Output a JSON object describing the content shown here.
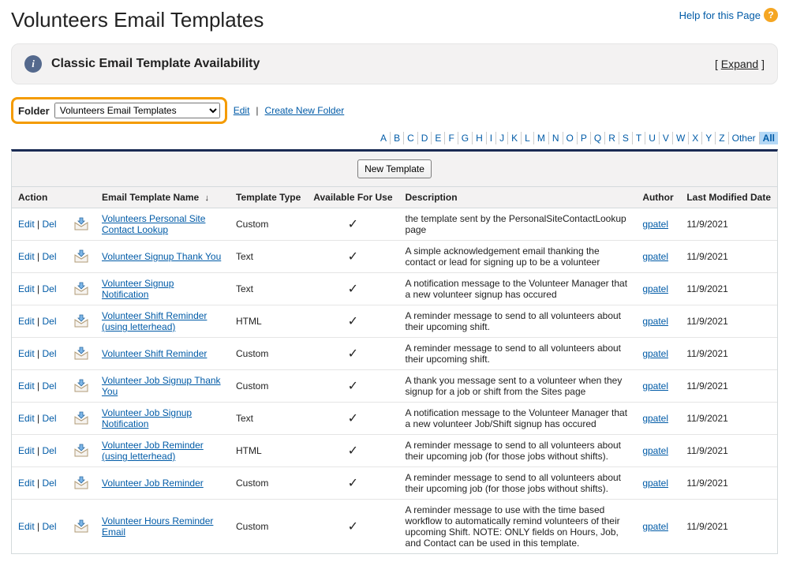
{
  "page": {
    "title": "Volunteers Email Templates",
    "help_label": "Help for this Page"
  },
  "banner": {
    "title": "Classic Email Template Availability",
    "expand_open": "[ ",
    "expand_label": "Expand",
    "expand_close": " ]"
  },
  "folder": {
    "label": "Folder",
    "selected": "Volunteers Email Templates",
    "edit_label": "Edit",
    "create_label": "Create New Folder"
  },
  "alpha": {
    "letters": [
      "A",
      "B",
      "C",
      "D",
      "E",
      "F",
      "G",
      "H",
      "I",
      "J",
      "K",
      "L",
      "M",
      "N",
      "O",
      "P",
      "Q",
      "R",
      "S",
      "T",
      "U",
      "V",
      "W",
      "X",
      "Y",
      "Z"
    ],
    "other_label": "Other",
    "all_label": "All",
    "active": "All"
  },
  "toolbar": {
    "new_template_label": "New Template"
  },
  "columns": {
    "action": "Action",
    "name": "Email Template Name",
    "type": "Template Type",
    "available": "Available For Use",
    "description": "Description",
    "author": "Author",
    "modified": "Last Modified Date"
  },
  "row_labels": {
    "edit": "Edit",
    "del": "Del",
    "sep": " | "
  },
  "rows": [
    {
      "name": "Volunteers Personal Site Contact Lookup",
      "type": "Custom",
      "available": true,
      "description": "the template sent by the PersonalSiteContactLookup page",
      "author": "gpatel",
      "modified": "11/9/2021"
    },
    {
      "name": "Volunteer Signup Thank You",
      "type": "Text",
      "available": true,
      "description": "A simple acknowledgement email thanking the contact or lead for signing up to be a volunteer",
      "author": "gpatel",
      "modified": "11/9/2021"
    },
    {
      "name": "Volunteer Signup Notification",
      "type": "Text",
      "available": true,
      "description": "A notification message to the Volunteer Manager that a new volunteer signup has occured",
      "author": "gpatel",
      "modified": "11/9/2021"
    },
    {
      "name": "Volunteer Shift Reminder (using letterhead)",
      "type": "HTML",
      "available": true,
      "description": "A reminder message to send to all volunteers about their upcoming shift.",
      "author": "gpatel",
      "modified": "11/9/2021"
    },
    {
      "name": "Volunteer Shift Reminder",
      "type": "Custom",
      "available": true,
      "description": "A reminder message to send to all volunteers about their upcoming shift.",
      "author": "gpatel",
      "modified": "11/9/2021"
    },
    {
      "name": "Volunteer Job Signup Thank You",
      "type": "Custom",
      "available": true,
      "description": "A thank you message sent to a volunteer when they signup for a job or shift from the Sites page",
      "author": "gpatel",
      "modified": "11/9/2021"
    },
    {
      "name": "Volunteer Job Signup Notification",
      "type": "Text",
      "available": true,
      "description": "A notification message to the Volunteer Manager that a new volunteer Job/Shift signup has occured",
      "author": "gpatel",
      "modified": "11/9/2021"
    },
    {
      "name": "Volunteer Job Reminder (using letterhead)",
      "type": "HTML",
      "available": true,
      "description": "A reminder message to send to all volunteers about their upcoming job (for those jobs without shifts).",
      "author": "gpatel",
      "modified": "11/9/2021"
    },
    {
      "name": "Volunteer Job Reminder",
      "type": "Custom",
      "available": true,
      "description": "A reminder message to send to all volunteers about their upcoming job (for those jobs without shifts).",
      "author": "gpatel",
      "modified": "11/9/2021"
    },
    {
      "name": "Volunteer Hours Reminder Email",
      "type": "Custom",
      "available": true,
      "description": "A reminder message to use with the time based workflow to automatically remind volunteers of their upcoming Shift. NOTE: ONLY fields on Hours, Job, and Contact can be used in this template.",
      "author": "gpatel",
      "modified": "11/9/2021"
    }
  ]
}
